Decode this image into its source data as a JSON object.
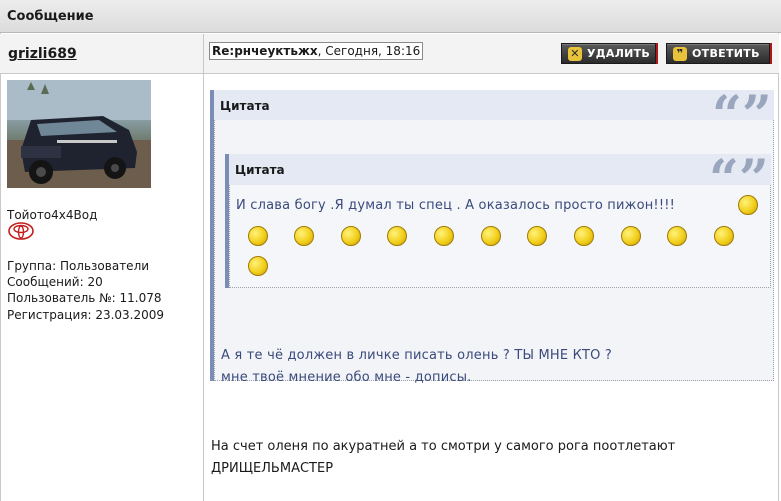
{
  "window": {
    "title": "Сообщение"
  },
  "author": {
    "username": "grizli689",
    "car_label": "Тойото4х4Вод",
    "group": "Группа: Пользователи",
    "messages": "Сообщений: 20",
    "user_number": "Пользователь №: 11.078",
    "registered": "Регистрация: 23.03.2009"
  },
  "post": {
    "title_prefix": "Re:",
    "title_subject": "рнчеуктьжх",
    "timestamp": ", Сегодня, 18:16",
    "delete_label": "УДАЛИТЬ",
    "reply_label": "ОТВЕТИТЬ",
    "outer_quote": {
      "label": "Цитата",
      "reply_line1": "А я те чё должен в личке писать олень ? ТЫ МНЕ КТО ?",
      "reply_line2": "мне твоё мнение обо мне - дописы."
    },
    "inner_quote": {
      "label": "Цитата",
      "text": "И слава богу .Я думал ты спец . А оказалось просто пижон!!!!"
    },
    "body_line1": "На счет оленя по акуратней а то смотри у самого рога поотлетают",
    "body_line2": "ДРИЩЕЛЬМАСТЕР"
  },
  "icons": {
    "delete": "close-icon",
    "reply": "quote-icon",
    "quote_marks": "quotation-mark-icon",
    "smiley": "smiley-icon",
    "car_brand": "toyota-logo-icon"
  },
  "colors": {
    "quote_border": "#7b8db6",
    "quote_header_bg": "#e4e9f3",
    "quote_text": "#3a4a7a",
    "button_bg": "#3a3a3a"
  },
  "smileys_count": 13
}
